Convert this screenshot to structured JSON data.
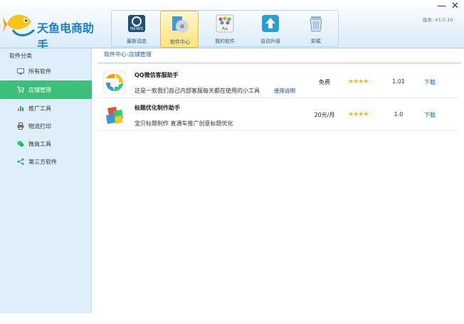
{
  "app": {
    "title": "天鱼电商助手",
    "version": "版本: V1.0.10",
    "minimize_glyph": "—",
    "close_glyph": "✕"
  },
  "nav": {
    "items": [
      {
        "label": "最新动态",
        "icon": "news-icon"
      },
      {
        "label": "软件中心",
        "icon": "software-disc-icon",
        "active": true
      },
      {
        "label": "我的软件",
        "icon": "my-apps-grid-icon"
      },
      {
        "label": "自动升级",
        "icon": "upgrade-arrow-icon"
      },
      {
        "label": "卸载",
        "icon": "trash-icon"
      }
    ]
  },
  "sidebar": {
    "title": "软件分类",
    "items": [
      {
        "label": "所有软件",
        "icon": "all-software-icon"
      },
      {
        "label": "店铺管理",
        "icon": "cart-icon",
        "active": true
      },
      {
        "label": "推广工具",
        "icon": "chart-icon"
      },
      {
        "label": "物流打印",
        "icon": "printer-icon"
      },
      {
        "label": "微商工具",
        "icon": "wechat-icon"
      },
      {
        "label": "第三方软件",
        "icon": "share-icon"
      }
    ]
  },
  "breadcrumb": "软件中心-店铺管理",
  "software_list": [
    {
      "name": "QQ微信客服助手",
      "desc": "这是一款我们自己内部客服每天都在使用的小工具",
      "help": "使用说明",
      "price": "免费",
      "rating": 4,
      "rating_max": 5,
      "version": "1.01",
      "download": "下载"
    },
    {
      "name": "标题优化制作助手",
      "desc": "宝贝标题制作 直通车推广创意标题优化",
      "price": "20元/月",
      "rating": 4,
      "rating_max": 5,
      "version": "1.0",
      "download": "下载"
    }
  ],
  "colors": {
    "accent_green": "#3cc079",
    "link_blue": "#1a64b0",
    "star": "#f1b51c"
  }
}
